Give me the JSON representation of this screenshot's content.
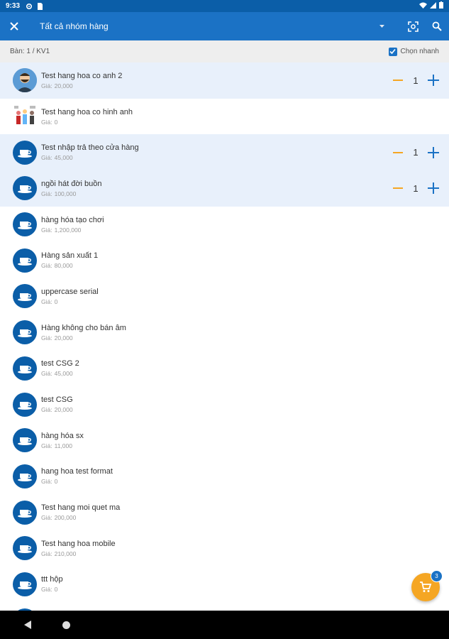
{
  "status_bar": {
    "time": "9:33",
    "icons": [
      "settings-icon",
      "sim-card-icon",
      "wifi-icon",
      "signal-icon",
      "battery-icon"
    ]
  },
  "app_bar": {
    "title": "Tất cả nhóm hàng",
    "icons": [
      "close-icon",
      "dropdown-arrow-icon",
      "barcode-scan-icon",
      "search-icon"
    ]
  },
  "sub_bar": {
    "table_label": "Bàn: 1 / KV1",
    "quick_select_label": "Chọn nhanh",
    "quick_select_checked": true
  },
  "price_label": "Giá:",
  "products": [
    {
      "name": "Test hang hoa co anh 2",
      "price": "20,000",
      "avatar": "person",
      "selected": true,
      "qty": "1"
    },
    {
      "name": "Test hang hoa co hinh anh",
      "price": "0",
      "avatar": "photo",
      "selected": false,
      "qty": ""
    },
    {
      "name": "Test nhập trả theo cửa hàng",
      "price": "45,000",
      "avatar": "cup",
      "selected": true,
      "qty": "1"
    },
    {
      "name": "ngồi hát đời buồn",
      "price": "100,000",
      "avatar": "cup",
      "selected": true,
      "qty": "1"
    },
    {
      "name": "hàng hóa tạo chơi",
      "price": "1,200,000",
      "avatar": "cup",
      "selected": false,
      "qty": ""
    },
    {
      "name": "Hàng sản xuất 1",
      "price": "80,000",
      "avatar": "cup",
      "selected": false,
      "qty": ""
    },
    {
      "name": "uppercase serial",
      "price": "0",
      "avatar": "cup",
      "selected": false,
      "qty": ""
    },
    {
      "name": "Hàng không cho bán âm",
      "price": "20,000",
      "avatar": "cup",
      "selected": false,
      "qty": ""
    },
    {
      "name": "test CSG 2",
      "price": "45,000",
      "avatar": "cup",
      "selected": false,
      "qty": ""
    },
    {
      "name": "test CSG",
      "price": "20,000",
      "avatar": "cup",
      "selected": false,
      "qty": ""
    },
    {
      "name": "hàng hóa sx",
      "price": "11,000",
      "avatar": "cup",
      "selected": false,
      "qty": ""
    },
    {
      "name": "hang hoa test format",
      "price": "0",
      "avatar": "cup",
      "selected": false,
      "qty": ""
    },
    {
      "name": "Test hang moi quet ma",
      "price": "200,000",
      "avatar": "cup",
      "selected": false,
      "qty": ""
    },
    {
      "name": "Test hang hoa mobile",
      "price": "210,000",
      "avatar": "cup",
      "selected": false,
      "qty": ""
    },
    {
      "name": "ttt hộp",
      "price": "0",
      "avatar": "cup",
      "selected": false,
      "qty": ""
    },
    {
      "name": "",
      "price": "",
      "avatar": "cup",
      "selected": false,
      "qty": ""
    }
  ],
  "cart": {
    "count": "3",
    "icon": "shopping-cart-icon"
  },
  "colors": {
    "app_bar": "#1b72c5",
    "status_bar": "#0b5ea8",
    "selected_row": "#e8f0fb",
    "minus": "#f5a623",
    "plus": "#1b72c5",
    "fab": "#f5a623"
  }
}
